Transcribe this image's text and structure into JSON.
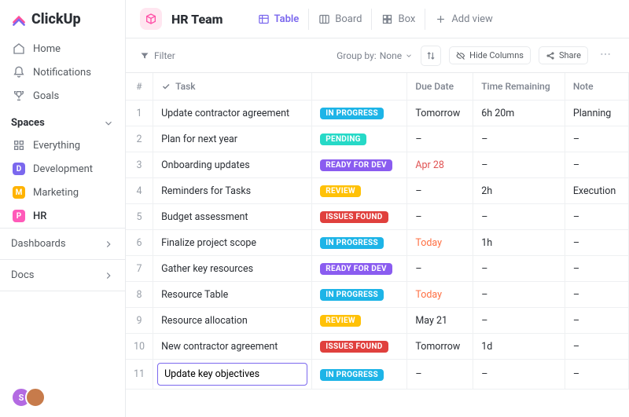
{
  "brand": "ClickUp",
  "sidebar": {
    "nav": [
      {
        "label": "Home",
        "icon": "home-icon"
      },
      {
        "label": "Notifications",
        "icon": "bell-icon"
      },
      {
        "label": "Goals",
        "icon": "trophy-icon"
      }
    ],
    "spaces_header": "Spaces",
    "spaces": [
      {
        "label": "Everything",
        "type": "all"
      },
      {
        "label": "Development",
        "letter": "D",
        "color": "#7b68ee"
      },
      {
        "label": "Marketing",
        "letter": "M",
        "color": "#ffb300"
      },
      {
        "label": "HR",
        "letter": "P",
        "color": "#ff5ab9",
        "active": true
      }
    ],
    "bottom": [
      {
        "label": "Dashboards"
      },
      {
        "label": "Docs"
      }
    ],
    "avatars": [
      {
        "letter": "S",
        "color": "#b36ae2"
      },
      {
        "letter": "",
        "color": "#c77b4b"
      }
    ]
  },
  "header": {
    "space_name": "HR Team",
    "views": [
      {
        "label": "Table",
        "active": true,
        "icon": "table-icon"
      },
      {
        "label": "Board",
        "active": false,
        "icon": "board-icon"
      },
      {
        "label": "Box",
        "active": false,
        "icon": "box-icon"
      },
      {
        "label": "Add view",
        "active": false,
        "icon": "plus-icon"
      }
    ]
  },
  "toolbar": {
    "filter_label": "Filter",
    "groupby_label": "Group by:",
    "groupby_value": "None",
    "hide_columns_label": "Hide Columns",
    "share_label": "Share"
  },
  "table": {
    "columns": {
      "index": "#",
      "task": "Task",
      "status": "",
      "due": "Due Date",
      "time": "Time Remaining",
      "note": "Note"
    },
    "status_colors": {
      "IN PROGRESS": "#1db4e7",
      "PENDING": "#26d9c7",
      "READY FOR DEV": "#8a5cf0",
      "REVIEW": "#ffc107",
      "ISSUES FOUND": "#e0403d"
    },
    "rows": [
      {
        "n": "1",
        "task": "Update contractor agreement",
        "status": "IN PROGRESS",
        "due": "Tomorrow",
        "time": "6h 20m",
        "note": "Planning"
      },
      {
        "n": "2",
        "task": "Plan for next year",
        "status": "PENDING",
        "due": "–",
        "time": "–",
        "note": "–"
      },
      {
        "n": "3",
        "task": "Onboarding updates",
        "status": "READY FOR DEV",
        "due": "Apr 28",
        "due_class": "due-apr",
        "time": "–",
        "note": "–"
      },
      {
        "n": "4",
        "task": "Reminders for Tasks",
        "status": "REVIEW",
        "due": "–",
        "time": "2h",
        "note": "Execution"
      },
      {
        "n": "5",
        "task": "Budget assessment",
        "status": "ISSUES FOUND",
        "due": "–",
        "time": "–",
        "note": "–"
      },
      {
        "n": "6",
        "task": "Finalize project scope",
        "status": "IN PROGRESS",
        "due": "Today",
        "due_class": "due-today",
        "time": "1h",
        "note": "–"
      },
      {
        "n": "7",
        "task": "Gather key resources",
        "status": "READY FOR DEV",
        "due": "–",
        "time": "–",
        "note": "–"
      },
      {
        "n": "8",
        "task": "Resource Table",
        "status": "IN PROGRESS",
        "due": "Today",
        "due_class": "due-today",
        "time": "–",
        "note": "–"
      },
      {
        "n": "9",
        "task": "Resource allocation",
        "status": "REVIEW",
        "due": "May 21",
        "time": "–",
        "note": "–"
      },
      {
        "n": "10",
        "task": "New contractor agreement",
        "status": "ISSUES FOUND",
        "due": "Tomorrow",
        "time": "1d",
        "note": "–"
      },
      {
        "n": "11",
        "task": "Update key objectives",
        "status": "IN PROGRESS",
        "due": "–",
        "time": "–",
        "note": "–",
        "editing": true
      }
    ]
  }
}
